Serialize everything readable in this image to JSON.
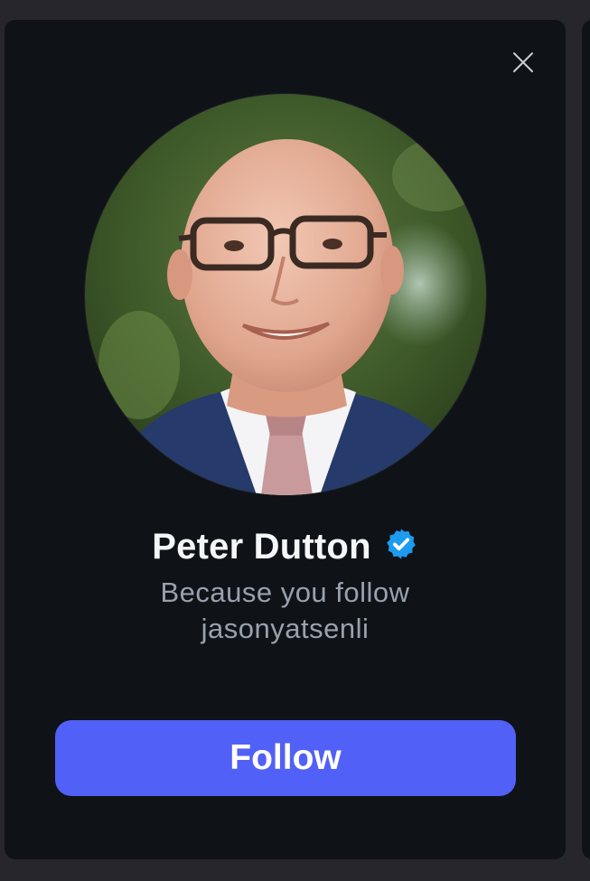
{
  "card": {
    "close_icon": "close-icon",
    "avatar_icon": "profile-photo",
    "name": "Peter Dutton",
    "verified_icon": "verified-badge-icon",
    "reason_line1": "Because you follow",
    "reason_line2": "jasonyatsenli",
    "follow_label": "Follow"
  },
  "colors": {
    "background": "#26262c",
    "card": "#0f1217",
    "accent": "#5160f6",
    "verified": "#1d9bf0",
    "secondary_text": "#98a2ae"
  }
}
